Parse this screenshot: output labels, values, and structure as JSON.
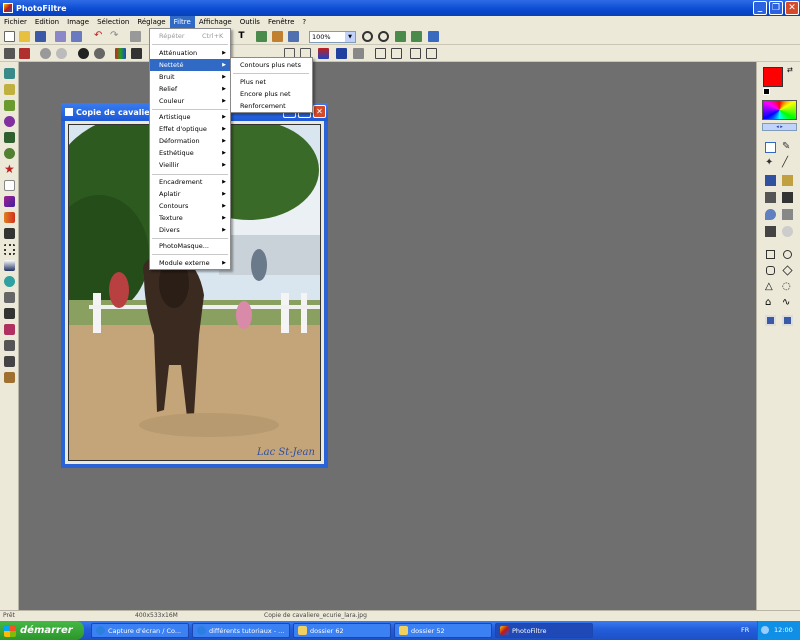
{
  "app": {
    "title": "PhotoFiltre"
  },
  "menubar": [
    "Fichier",
    "Edition",
    "Image",
    "Sélection",
    "Réglage",
    "Filtre",
    "Affichage",
    "Outils",
    "Fenêtre",
    "?"
  ],
  "toolbar": {
    "zoom": "100%",
    "text_tool": "T"
  },
  "filter_menu": {
    "repeat": "Répéter",
    "repeat_shortcut": "Ctrl+K",
    "items": [
      "Atténuation",
      "Netteté",
      "Bruit",
      "Relief",
      "Couleur",
      "Artistique",
      "Effet d'optique",
      "Déformation",
      "Esthétique",
      "Vieillir",
      "Encadrement",
      "Aplatir",
      "Contours",
      "Texture",
      "Divers",
      "PhotoMasque...",
      "Module externe"
    ]
  },
  "sharpness_submenu": [
    "Contours plus nets",
    "Plus net",
    "Encore plus net",
    "Renforcement"
  ],
  "document": {
    "title": "Copie de cavaliere",
    "watermark": "Lac St-Jean"
  },
  "statusbar": {
    "state": "Prêt",
    "dimensions": "400x533x16M",
    "filename": "Copie de cavaliere_ecurie_lara.jpg"
  },
  "taskbar": {
    "start": "démarrer",
    "tasks": [
      "Capture d'écran / Co...",
      "différents tutoriaux - ...",
      "dossier 62",
      "dossier 52",
      "PhotoFiltre"
    ],
    "lang": "FR",
    "clock": "12:00"
  },
  "colors": {
    "foreground": "#ff0000",
    "background": "#ffffff",
    "accent": "#316ac5"
  }
}
